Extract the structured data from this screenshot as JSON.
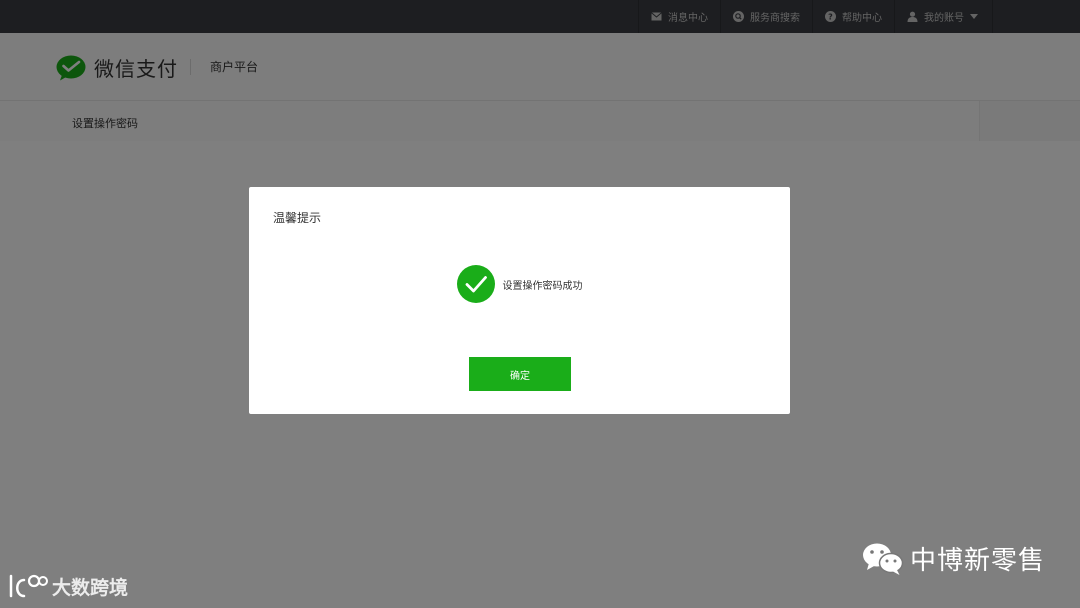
{
  "topnav": {
    "items": [
      {
        "label": "消息中心",
        "icon": "mail-icon"
      },
      {
        "label": "服务商搜索",
        "icon": "search-circle-icon"
      },
      {
        "label": "帮助中心",
        "icon": "help-icon"
      },
      {
        "label": "我的账号",
        "icon": "user-icon"
      }
    ]
  },
  "header": {
    "brand": "微信支付",
    "subtitle": "商户平台"
  },
  "breadcrumb": {
    "current": "设置操作密码"
  },
  "dialog": {
    "title": "温馨提示",
    "message": "设置操作密码成功",
    "confirm_label": "确定"
  },
  "watermarks": {
    "right": "中博新零售",
    "left": "大数跨境"
  },
  "colors": {
    "accent": "#1aad19",
    "topbar": "#3a3c42",
    "overlay": "rgba(0,0,0,0.5)"
  }
}
